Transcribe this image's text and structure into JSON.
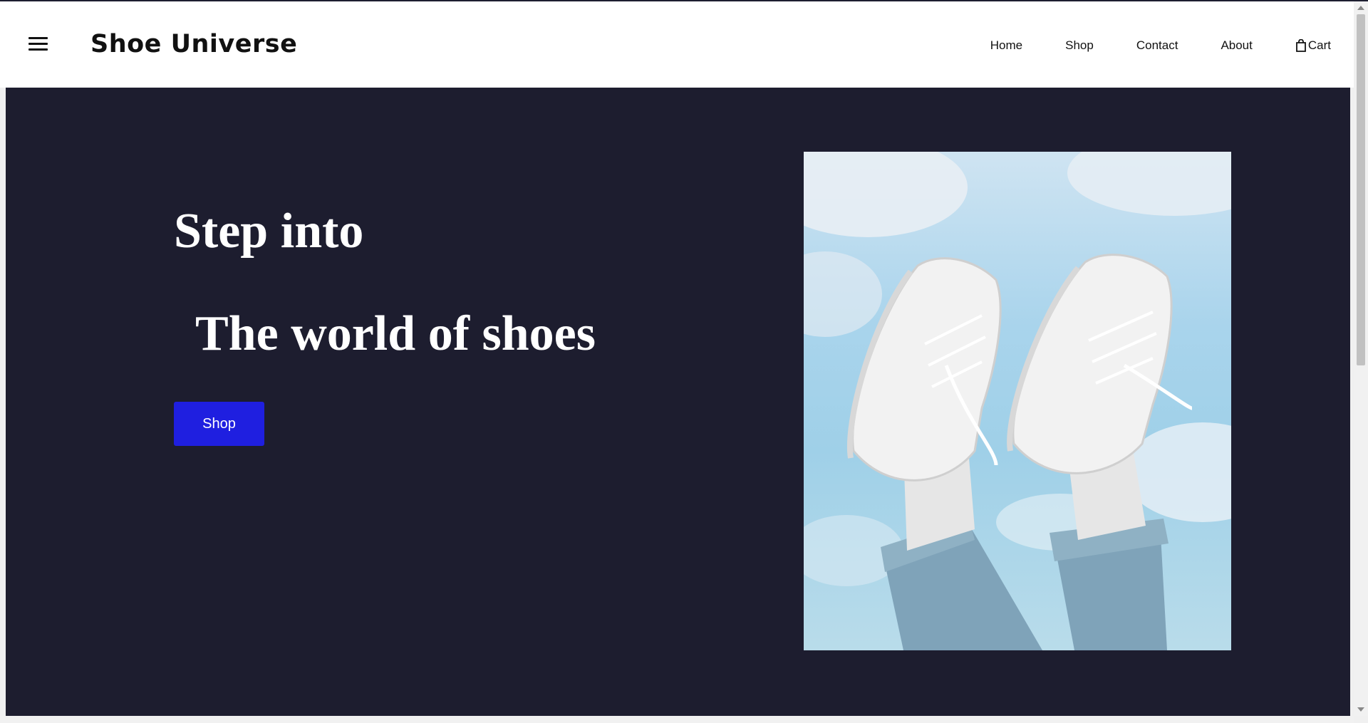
{
  "navbar": {
    "brand": "Shoe Universe",
    "links": [
      {
        "label": "Home"
      },
      {
        "label": "Shop"
      },
      {
        "label": "Contact"
      },
      {
        "label": "About"
      }
    ],
    "cart_label": "Cart"
  },
  "hero": {
    "headline_line1": "Step into",
    "headline_line2": "The world of shoes",
    "cta_label": "Shop",
    "image_icon": "sneakers-photo"
  },
  "colors": {
    "hero_background": "#1d1d2f",
    "cta_button": "#1f1fe0",
    "text_light": "#ffffff"
  }
}
